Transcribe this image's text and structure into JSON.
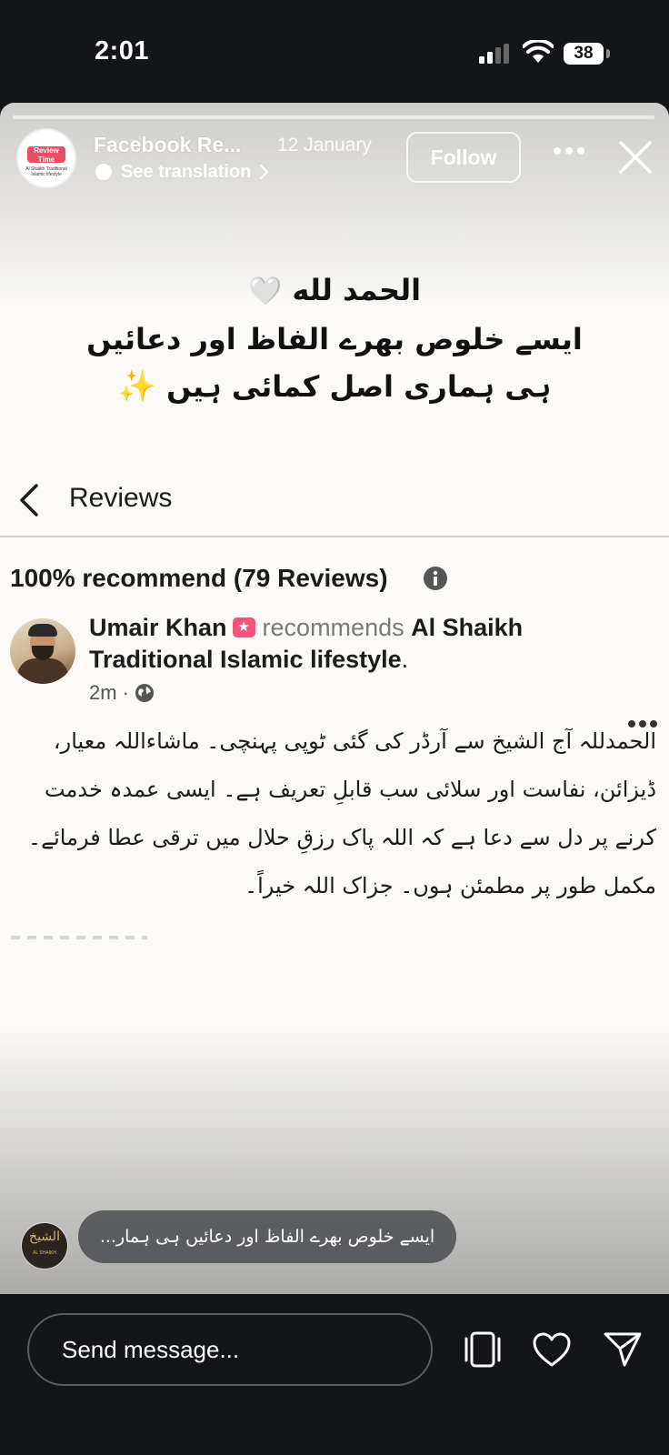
{
  "status_bar": {
    "time": "2:01",
    "battery": "38"
  },
  "story": {
    "account_name": "Facebook Re...",
    "date": "12 January",
    "translate_label": "See translation",
    "follow_label": "Follow",
    "avatar_badge": "Review Time",
    "avatar_sub": "Al Shaikh Traditional Islamic lifestyle",
    "headline_lines": [
      "الحمد لله",
      "ایسے خلوص بھرے الفاظ اور دعائیں",
      "ہی ہماری اصل کمائی ہیں"
    ],
    "heart_emoji": "🤍",
    "sparkle_emoji": "✨"
  },
  "reviews": {
    "title": "Reviews",
    "summary": "100% recommend (79 Reviews)",
    "review": {
      "reviewer": "Umair Khan",
      "recommends": "recommends",
      "page": "Al Shaikh Traditional Islamic lifestyle",
      "period": ".",
      "time": "2m ·",
      "body_lines": [
        "الحمدللہ آج الشیخ سے آرڈر کی گئی ٹوپی پہنچی۔ ماشاءاللہ معیار،",
        "ڈیزائن، نفاست اور سلائی سب قابلِ تعریف ہے۔ ایسی عمدہ خدمت",
        "کرنے پر دل سے دعا ہے کہ اللہ پاک رزقِ حلال میں ترقی عطا فرمائے۔",
        "مکمل طور پر مطمئن ہوں۔ جزاک اللہ خیراً۔"
      ]
    }
  },
  "reply": {
    "logo": "الشیخ",
    "logo_sub": "AL SHAIKH",
    "text": "ایسے خلوص بھرے الفاظ اور دعائیں ہی ہمار..."
  },
  "composer": {
    "placeholder": "Send message..."
  },
  "icons": {
    "back": "chevron-left-icon",
    "close": "close-icon",
    "more": "more-horizontal-icon",
    "info": "info-icon",
    "globe": "globe-icon",
    "pages": "swipe-pages-icon",
    "like": "heart-icon",
    "share": "send-icon"
  }
}
